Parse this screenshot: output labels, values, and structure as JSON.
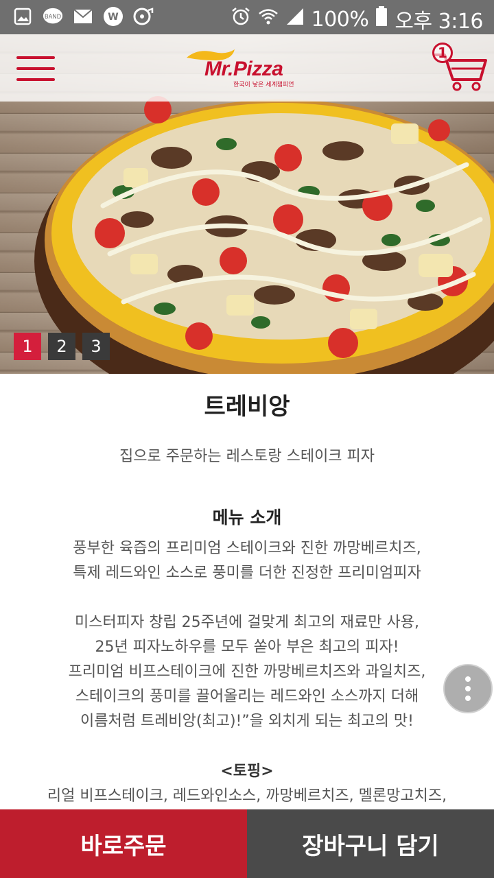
{
  "status_bar": {
    "notification_icons": [
      "gallery-icon",
      "band-icon",
      "mail-icon",
      "w-icon",
      "music-icon"
    ],
    "band_label": "BAND",
    "w_label": "W",
    "battery_text": "100%",
    "time_text": "오후 3:16"
  },
  "header": {
    "logo_text": "Mr.Pizza",
    "logo_subtext": "한국이 낳은 세계챔피언",
    "cart_count": "1"
  },
  "hero": {
    "pager": [
      "1",
      "2",
      "3"
    ],
    "active_page": "1"
  },
  "product": {
    "title": "트레비앙",
    "subtitle": "집으로 주문하는 레스토랑 스테이크 피자",
    "section_title": "메뉴 소개",
    "intro_lines": [
      "풍부한 육즙의 프리미엄 스테이크와 진한 까망베르치즈,",
      "특제 레드와인 소스로 풍미를 더한 진정한 프리미엄피자"
    ],
    "story_lines": [
      "미스터피자 창립 25주년에 걸맞게 최고의 재료만 사용,",
      "25년 피자노하우를 모두 쏟아 부은 최고의 피자!",
      "프리미엄 비프스테이크에 진한 까망베르치즈와 과일치즈,",
      "스테이크의 풍미를 끌어올리는 레드와인 소스까지 더해",
      "이름처럼 트레비앙(최고)!”을 외치게 되는 최고의 맛!"
    ],
    "topping_title": "<토핑>",
    "topping_text": "리얼 비프스테이크, 레드와인소스, 까망베르치즈, 멜론망고치즈,"
  },
  "bottom_bar": {
    "order_label": "바로주문",
    "cart_label": "장바구니 담기"
  },
  "colors": {
    "accent": "#be1e2d",
    "dark_button": "#4a4a4a",
    "status_bar": "#6f6f6f"
  }
}
